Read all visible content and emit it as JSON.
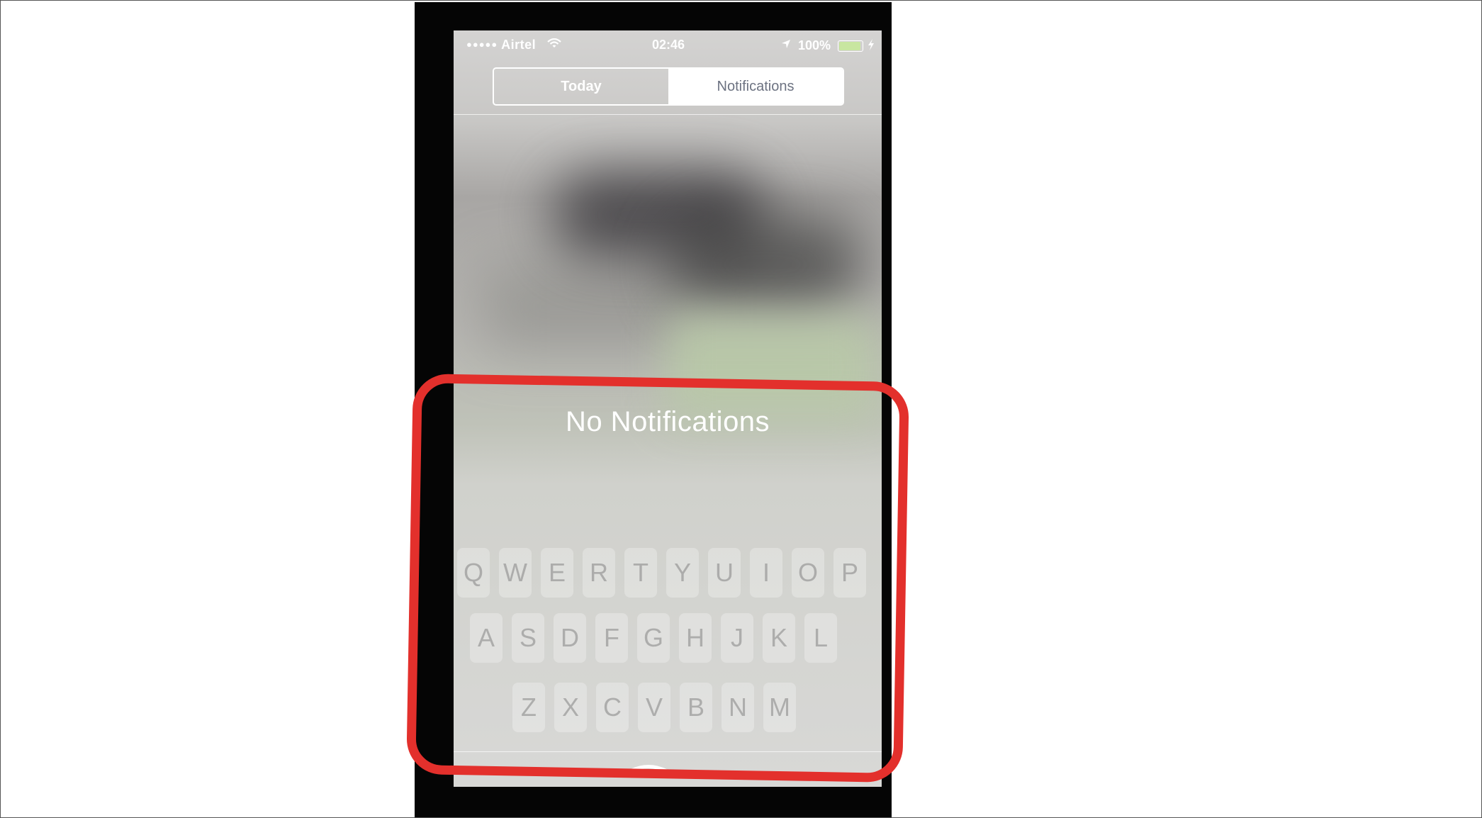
{
  "status_bar": {
    "signal_dots": "●●●●●",
    "carrier": "Airtel",
    "time": "02:46",
    "battery_percent": "100%",
    "battery_level": 1.0
  },
  "segmented_control": {
    "tabs": [
      {
        "label": "Today",
        "selected": false
      },
      {
        "label": "Notifications",
        "selected": true
      }
    ]
  },
  "notification_center": {
    "empty_message": "No Notifications"
  },
  "keyboard_ghost": {
    "row1": [
      "Q",
      "W",
      "E",
      "R",
      "T",
      "Y",
      "U",
      "I",
      "O",
      "P"
    ],
    "row2": [
      "A",
      "S",
      "D",
      "F",
      "G",
      "H",
      "J",
      "K",
      "L"
    ],
    "row3": [
      "Z",
      "X",
      "C",
      "V",
      "B",
      "N",
      "M"
    ]
  },
  "annotation": {
    "highlight_color": "#e3302c"
  }
}
